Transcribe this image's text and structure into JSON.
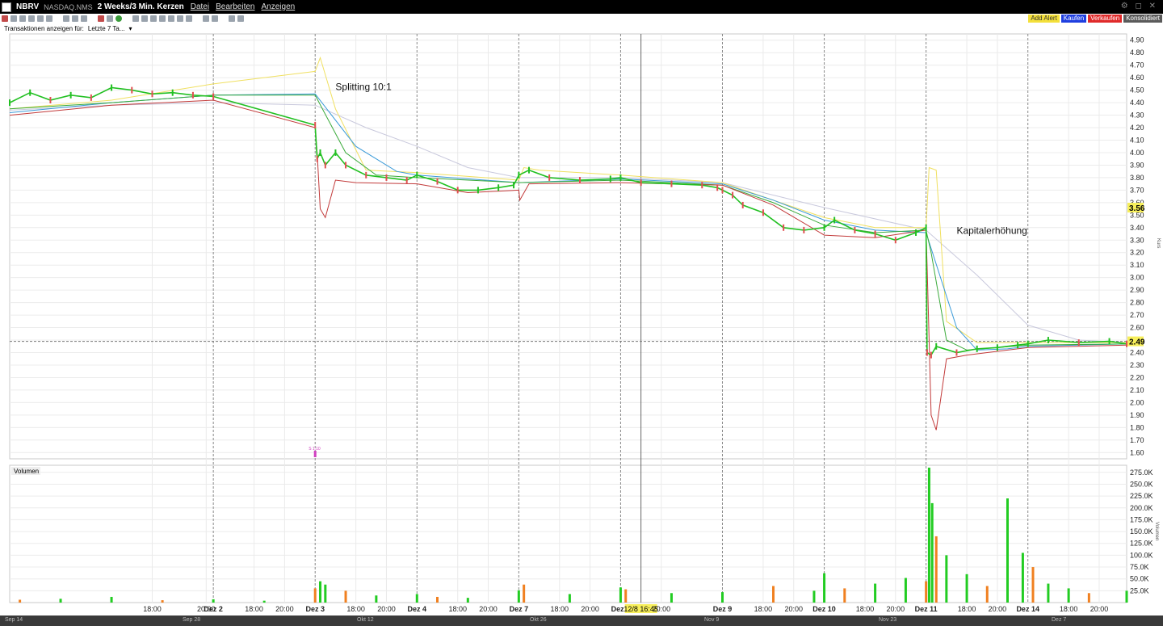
{
  "header": {
    "symbol": "NBRV",
    "exchange": "NASDAQ.NMS",
    "period": "2 Weeks/3 Min. Kerzen",
    "menu": [
      "Datei",
      "Bearbeiten",
      "Anzeigen"
    ]
  },
  "trade_buttons": {
    "alert": "Add Alert",
    "buy": "Kaufen",
    "sell": "Verkaufen",
    "consolidated": "Konsolidiert"
  },
  "transactions": {
    "label": "Transaktionen anzeigen für:",
    "value": "Letzte 7 Ta..."
  },
  "colors": {
    "candle_up": "#22c022",
    "candle_down": "#e05050",
    "ma_red": "#c23a3a",
    "ma_green": "#3aaa3a",
    "ma_blue": "#3a9ad8",
    "ma_yellow": "#f0e060",
    "ma_gray": "#c8c8dc",
    "vol_green": "#22cc22",
    "vol_orange": "#f08020",
    "highlight": "#f7ef5a"
  },
  "chart_data": {
    "type": "line",
    "title": "",
    "price_axis": {
      "ylim": [
        1.55,
        4.95
      ],
      "ticks": [
        "4.90",
        "4.80",
        "4.70",
        "4.60",
        "4.50",
        "4.40",
        "4.30",
        "4.20",
        "4.10",
        "4.00",
        "3.90",
        "3.80",
        "3.70",
        "3.60",
        "3.50",
        "3.40",
        "3.30",
        "3.20",
        "3.10",
        "3.00",
        "2.90",
        "2.80",
        "2.70",
        "2.60",
        "2.50",
        "2.40",
        "2.30",
        "2.20",
        "2.10",
        "2.00",
        "1.90",
        "1.80",
        "1.70",
        "1.60"
      ],
      "label": "Kurs",
      "current_price": "2.49",
      "marker_price": "3.56"
    },
    "x_ticks": [
      "18:00",
      "20:00",
      "Dez 2",
      "18:00",
      "20:00",
      "Dez 3",
      "18:00",
      "20:00",
      "Dez 4",
      "18:00",
      "20:00",
      "Dez 7",
      "18:00",
      "20:00",
      "Dez 8",
      "12/8 16:45",
      "20:00",
      "Dez 9",
      "18:00",
      "20:00",
      "Dez 10",
      "18:00",
      "20:00",
      "Dez 11",
      "18:00",
      "20:00",
      "Dez 14",
      "18:00",
      "20:00"
    ],
    "x_tick_index": [
      0.4,
      0.93,
      1.0,
      1.4,
      1.7,
      2.0,
      2.4,
      2.7,
      3.0,
      3.4,
      3.7,
      4.0,
      4.4,
      4.7,
      5.0,
      5.2,
      5.4,
      6.0,
      6.4,
      6.7,
      7.0,
      7.4,
      7.7,
      8.0,
      8.4,
      8.7,
      9.0,
      9.4,
      9.7
    ],
    "bold_ticks": [
      "Dez 2",
      "Dez 3",
      "Dez 4",
      "Dez 7",
      "Dez 8",
      "Dez 9",
      "Dez 10",
      "Dez 11",
      "Dez 14"
    ],
    "x_range": [
      -1.0,
      9.97
    ],
    "annotations": [
      {
        "text": "Splitting 10:1",
        "x": 2.2,
        "y": 4.5
      },
      {
        "text": "Kapitalerhöhung",
        "x": 8.3,
        "y": 3.35
      }
    ],
    "split_marker_label": "S 1:10",
    "series": [
      {
        "name": "",
        "key": "price",
        "x": [
          -1.0,
          -0.8,
          -0.6,
          -0.4,
          -0.2,
          0.0,
          0.2,
          0.4,
          0.6,
          0.8,
          1.0,
          2.0,
          2.02,
          2.05,
          2.1,
          2.2,
          2.3,
          2.5,
          2.7,
          2.9,
          3.0,
          3.2,
          3.4,
          3.6,
          3.8,
          3.95,
          4.0,
          4.1,
          4.3,
          4.6,
          4.9,
          5.0,
          5.2,
          5.5,
          5.8,
          5.95,
          6.0,
          6.1,
          6.2,
          6.4,
          6.6,
          6.8,
          7.0,
          7.1,
          7.3,
          7.5,
          7.7,
          7.9,
          8.0,
          8.01,
          8.05,
          8.1,
          8.3,
          8.5,
          8.7,
          8.9,
          9.0,
          9.2,
          9.5,
          9.8,
          9.97
        ],
        "y": [
          4.4,
          4.48,
          4.42,
          4.46,
          4.44,
          4.52,
          4.5,
          4.47,
          4.48,
          4.46,
          4.45,
          4.22,
          3.95,
          4.0,
          3.9,
          4.0,
          3.9,
          3.82,
          3.8,
          3.78,
          3.82,
          3.77,
          3.7,
          3.7,
          3.72,
          3.74,
          3.82,
          3.86,
          3.8,
          3.78,
          3.79,
          3.8,
          3.76,
          3.75,
          3.74,
          3.72,
          3.7,
          3.66,
          3.58,
          3.52,
          3.4,
          3.38,
          3.4,
          3.46,
          3.38,
          3.35,
          3.3,
          3.36,
          3.4,
          2.4,
          2.38,
          2.45,
          2.4,
          2.43,
          2.44,
          2.46,
          2.47,
          2.5,
          2.48,
          2.49,
          2.47
        ]
      },
      {
        "name": "",
        "key": "ma_fast",
        "x": [
          -1.0,
          0.0,
          1.0,
          2.0,
          2.02,
          2.05,
          2.1,
          2.2,
          2.4,
          3.0,
          3.5,
          4.0,
          4.01,
          4.1,
          5.0,
          6.0,
          6.5,
          7.0,
          7.5,
          8.0,
          8.01,
          8.05,
          8.1,
          8.2,
          8.4,
          9.0,
          9.97
        ],
        "y": [
          4.3,
          4.38,
          4.42,
          4.2,
          4.0,
          3.55,
          3.48,
          3.78,
          3.76,
          3.75,
          3.68,
          3.7,
          3.62,
          3.75,
          3.76,
          3.74,
          3.58,
          3.34,
          3.32,
          3.38,
          3.1,
          1.9,
          1.78,
          2.35,
          2.38,
          2.44,
          2.46
        ]
      },
      {
        "name": "",
        "key": "ma_mid",
        "x": [
          -1.0,
          0.0,
          1.0,
          2.0,
          2.3,
          2.6,
          3.0,
          4.0,
          5.0,
          6.0,
          6.5,
          7.0,
          7.5,
          8.0,
          8.05,
          8.2,
          8.4,
          8.7,
          9.0,
          9.97
        ],
        "y": [
          4.35,
          4.4,
          4.46,
          4.46,
          4.0,
          3.82,
          3.8,
          3.76,
          3.78,
          3.74,
          3.6,
          3.42,
          3.36,
          3.38,
          3.2,
          2.5,
          2.42,
          2.44,
          2.46,
          2.47
        ]
      },
      {
        "name": "",
        "key": "ma_blue",
        "x": [
          -1.0,
          0.0,
          1.0,
          2.0,
          2.4,
          2.8,
          3.0,
          4.0,
          5.0,
          6.0,
          6.5,
          7.0,
          7.5,
          8.0,
          8.3,
          8.5,
          8.8,
          9.0,
          9.97
        ],
        "y": [
          4.32,
          4.4,
          4.46,
          4.47,
          4.05,
          3.85,
          3.82,
          3.76,
          3.79,
          3.75,
          3.62,
          3.46,
          3.38,
          3.36,
          2.6,
          2.42,
          2.43,
          2.45,
          2.47
        ]
      },
      {
        "name": "",
        "key": "ma_yellow",
        "x": [
          -1.0,
          0.0,
          1.0,
          2.0,
          2.05,
          2.2,
          2.5,
          3.0,
          4.0,
          4.05,
          4.2,
          5.0,
          6.0,
          6.5,
          7.0,
          7.5,
          8.0,
          8.03,
          8.1,
          8.2,
          8.5,
          9.0,
          9.97
        ],
        "y": [
          4.35,
          4.42,
          4.55,
          4.65,
          4.76,
          4.35,
          3.86,
          3.84,
          3.78,
          3.88,
          3.86,
          3.82,
          3.76,
          3.62,
          3.48,
          3.4,
          3.4,
          3.88,
          3.86,
          2.65,
          2.48,
          2.48,
          2.48
        ]
      },
      {
        "name": "",
        "key": "ma_gray",
        "x": [
          -1.0,
          0.0,
          1.0,
          2.0,
          2.5,
          3.0,
          3.5,
          4.0,
          5.0,
          6.0,
          7.0,
          8.0,
          8.5,
          9.0,
          9.5,
          9.97
        ],
        "y": [
          4.34,
          4.38,
          4.4,
          4.38,
          4.2,
          4.05,
          3.88,
          3.8,
          3.8,
          3.76,
          3.56,
          3.38,
          3.02,
          2.62,
          2.5,
          2.48
        ]
      }
    ],
    "volume": {
      "label": "Volumen",
      "ylim": [
        0,
        290000
      ],
      "ticks": [
        "275.0K",
        "250.0K",
        "225.0K",
        "200.0K",
        "175.0K",
        "150.0K",
        "125.0K",
        "100.0K",
        "75.0K",
        "50.0K",
        "25.0K"
      ],
      "x": [
        -0.9,
        -0.5,
        0.0,
        0.5,
        1.0,
        1.5,
        2.0,
        2.05,
        2.1,
        2.3,
        2.6,
        3.0,
        3.2,
        3.5,
        4.0,
        4.05,
        4.5,
        5.0,
        5.05,
        5.5,
        6.0,
        6.5,
        6.9,
        7.0,
        7.2,
        7.5,
        7.8,
        8.0,
        8.03,
        8.06,
        8.1,
        8.2,
        8.4,
        8.6,
        8.8,
        8.95,
        9.05,
        9.2,
        9.4,
        9.6,
        9.97
      ],
      "values": [
        6000,
        8000,
        12000,
        5000,
        7000,
        4000,
        30000,
        45000,
        38000,
        25000,
        15000,
        18000,
        12000,
        10000,
        26000,
        38000,
        18000,
        32000,
        28000,
        20000,
        22000,
        35000,
        25000,
        62000,
        30000,
        40000,
        52000,
        45000,
        285000,
        210000,
        140000,
        100000,
        60000,
        35000,
        220000,
        105000,
        75000,
        40000,
        30000,
        20000,
        25000
      ]
    }
  }
}
